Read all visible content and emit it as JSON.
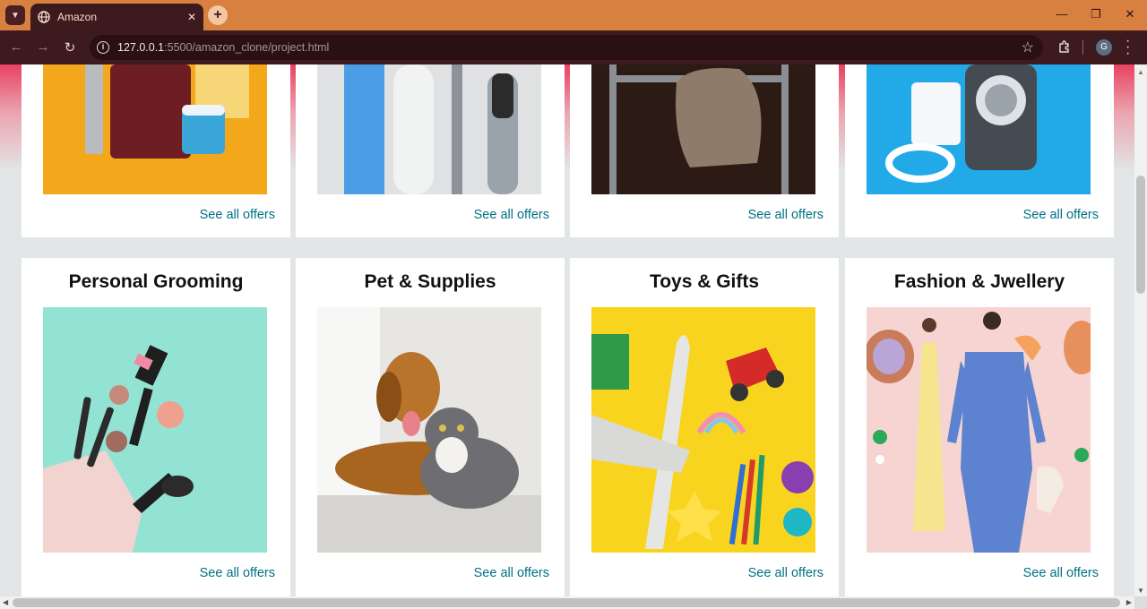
{
  "browser": {
    "tab_title": "Amazon",
    "url_host": "127.0.0.1",
    "url_path": ":5500/amazon_clone/project.html",
    "profile_initial": "G",
    "theme_color": "#d8803f"
  },
  "icons": {
    "tab_menu": "chevron-down-icon",
    "tab_favicon": "globe-icon",
    "tab_close": "close-icon",
    "new_tab": "plus-icon",
    "back": "arrow-left-icon",
    "forward": "arrow-right-icon",
    "reload": "reload-icon",
    "site_info": "info-icon",
    "bookmark": "star-icon",
    "extensions": "puzzle-icon",
    "menu": "kebab-icon"
  },
  "page": {
    "link_color": "#007185",
    "top_cards": [
      {
        "offers": "See all offers",
        "image": "skincare-products"
      },
      {
        "offers": "See all offers",
        "image": "grooming-tools"
      },
      {
        "offers": "See all offers",
        "image": "office-chair"
      },
      {
        "offers": "See all offers",
        "image": "phone-charger"
      }
    ],
    "cards": [
      {
        "title": "Personal Grooming",
        "offers": "See all offers",
        "image": "makeup-bag"
      },
      {
        "title": "Pet & Supplies",
        "offers": "See all offers",
        "image": "dog-and-cat"
      },
      {
        "title": "Toys & Gifts",
        "offers": "See all offers",
        "image": "toy-plane-car"
      },
      {
        "title": "Fashion & Jwellery",
        "offers": "See all offers",
        "image": "models-accessories"
      }
    ]
  }
}
